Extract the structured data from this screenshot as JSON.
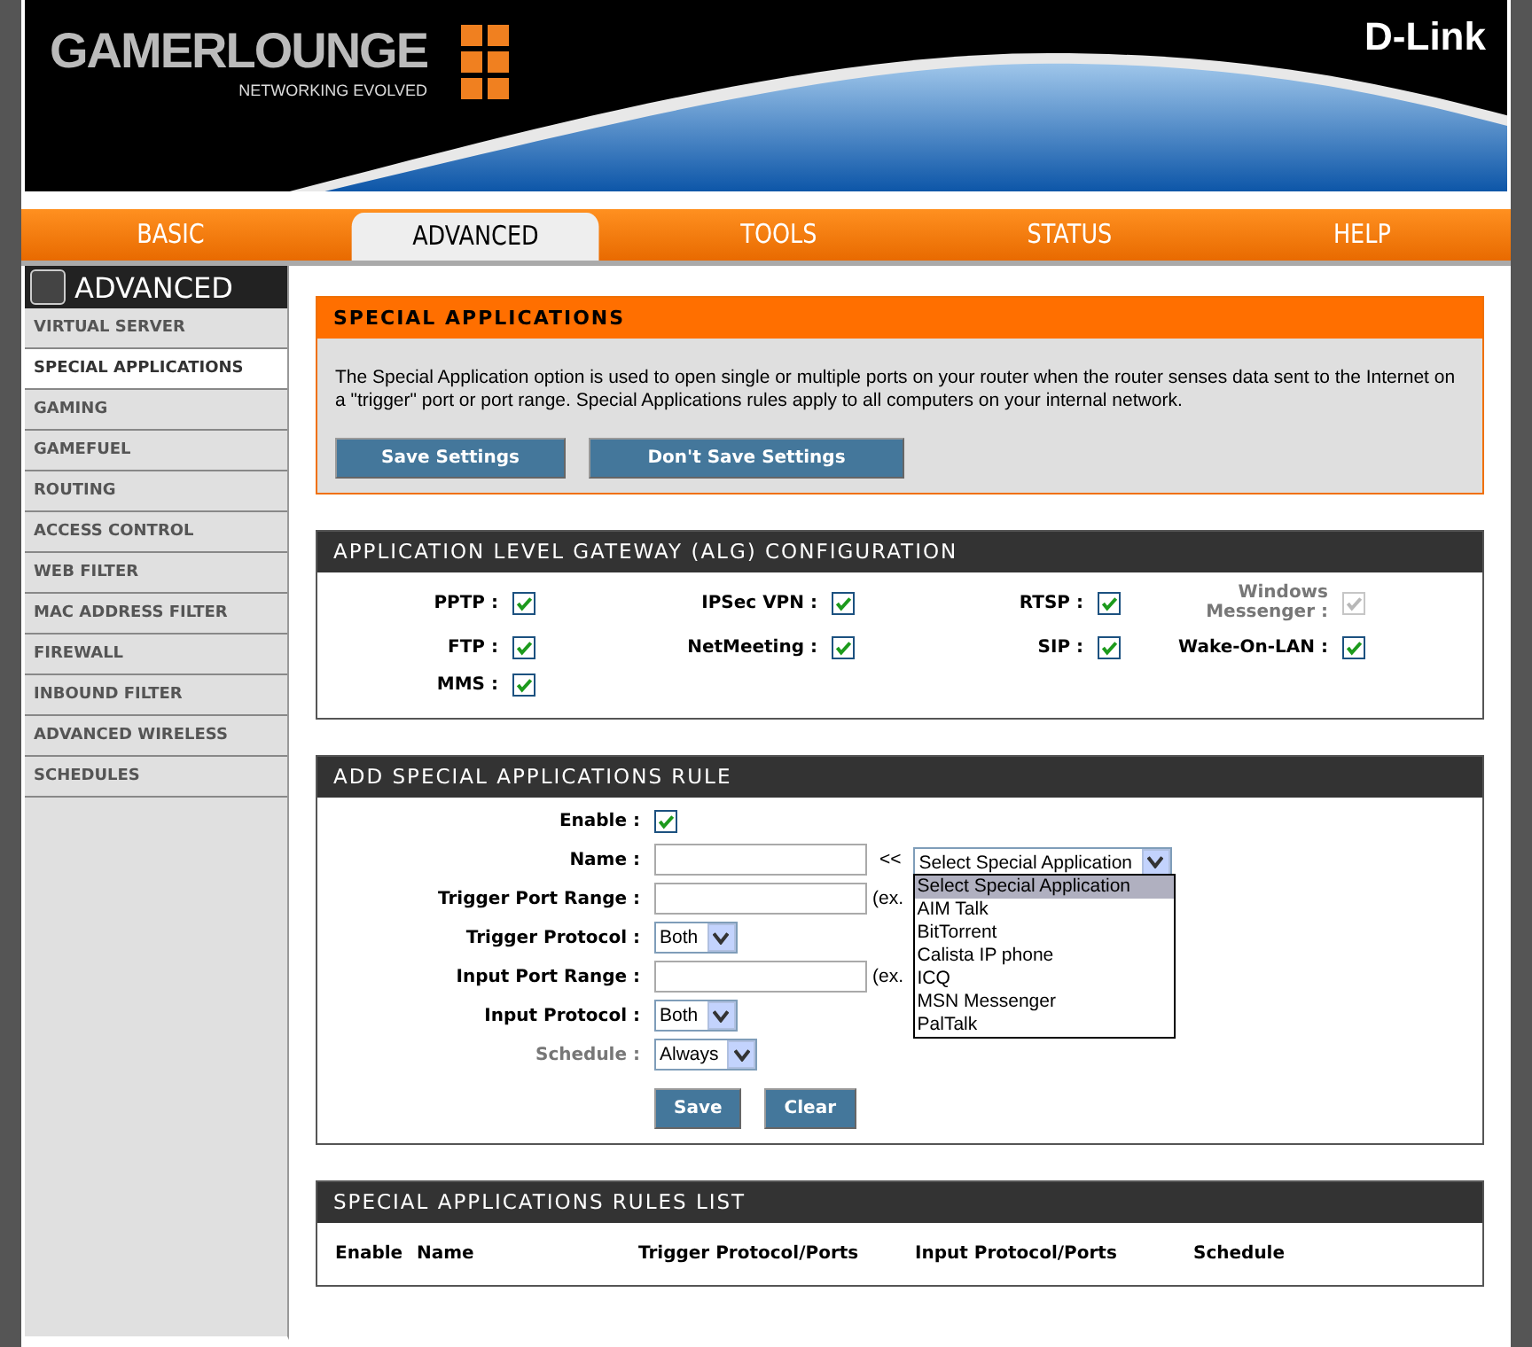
{
  "header": {
    "logo": "GAMERLOUNGE",
    "logo_tagline": "NETWORKING EVOLVED",
    "brand": "D-Link"
  },
  "tabs": [
    {
      "label": "BASIC",
      "selected": false
    },
    {
      "label": "ADVANCED",
      "selected": true
    },
    {
      "label": "TOOLS",
      "selected": false
    },
    {
      "label": "STATUS",
      "selected": false
    },
    {
      "label": "HELP",
      "selected": false
    }
  ],
  "sidebar": {
    "title": "ADVANCED",
    "items": [
      {
        "label": "VIRTUAL SERVER",
        "selected": false
      },
      {
        "label": "SPECIAL APPLICATIONS",
        "selected": true
      },
      {
        "label": "GAMING",
        "selected": false
      },
      {
        "label": "GAMEFUEL",
        "selected": false
      },
      {
        "label": "ROUTING",
        "selected": false
      },
      {
        "label": "ACCESS CONTROL",
        "selected": false
      },
      {
        "label": "WEB FILTER",
        "selected": false
      },
      {
        "label": "MAC ADDRESS FILTER",
        "selected": false
      },
      {
        "label": "FIREWALL",
        "selected": false
      },
      {
        "label": "INBOUND FILTER",
        "selected": false
      },
      {
        "label": "ADVANCED WIRELESS",
        "selected": false
      },
      {
        "label": "SCHEDULES",
        "selected": false
      }
    ]
  },
  "intro": {
    "title": "SPECIAL APPLICATIONS",
    "text": "The Special Application option is used to open single or multiple ports on your router when the router senses data sent to the Internet on a \"trigger\" port or port range. Special Applications rules apply to all computers on your internal network.",
    "buttons": [
      "Save Settings",
      "Don't Save Settings"
    ]
  },
  "alg": {
    "title": "APPLICATION LEVEL GATEWAY (ALG) CONFIGURATION",
    "items": [
      {
        "label": "PPTP :",
        "checked": true,
        "disabled": false
      },
      {
        "label": "IPSec VPN :",
        "checked": true,
        "disabled": false
      },
      {
        "label": "RTSP :",
        "checked": true,
        "disabled": false
      },
      {
        "label": "Windows Messenger :",
        "checked": true,
        "disabled": true
      },
      {
        "label": "FTP :",
        "checked": true,
        "disabled": false
      },
      {
        "label": "NetMeeting :",
        "checked": true,
        "disabled": false
      },
      {
        "label": "SIP :",
        "checked": true,
        "disabled": false
      },
      {
        "label": "Wake-On-LAN :",
        "checked": true,
        "disabled": false
      },
      {
        "label": "MMS :",
        "checked": true,
        "disabled": false
      }
    ]
  },
  "add_rule": {
    "title": "ADD SPECIAL APPLICATIONS RULE",
    "rows": [
      {
        "kind": "checkbox",
        "label": "Enable :",
        "checked": true,
        "disabled": false
      },
      {
        "kind": "name",
        "label": "Name :",
        "disabled": false,
        "value": "",
        "arrow": "<<",
        "select": "Select Special Application",
        "options": [
          {
            "label": "Select Special Application",
            "selected": true
          },
          {
            "label": "AIM Talk",
            "selected": false
          },
          {
            "label": "BitTorrent",
            "selected": false
          },
          {
            "label": "Calista IP phone",
            "selected": false
          },
          {
            "label": "ICQ",
            "selected": false
          },
          {
            "label": "MSN Messenger",
            "selected": false
          },
          {
            "label": "PalTalk",
            "selected": false
          }
        ]
      },
      {
        "kind": "text",
        "label": "Trigger Port Range :",
        "disabled": false,
        "value": "",
        "hint": "(ex."
      },
      {
        "kind": "select",
        "label": "Trigger Protocol :",
        "disabled": false,
        "value": "Both"
      },
      {
        "kind": "text",
        "label": "Input Port Range :",
        "disabled": false,
        "value": "",
        "hint": "(ex."
      },
      {
        "kind": "select",
        "label": "Input Protocol :",
        "disabled": false,
        "value": "Both"
      },
      {
        "kind": "select",
        "label": "Schedule :",
        "disabled": true,
        "value": "Always"
      }
    ],
    "buttons": [
      "Save",
      "Clear"
    ]
  },
  "rules_list": {
    "title": "SPECIAL APPLICATIONS RULES LIST",
    "columns": [
      "Enable",
      "Name",
      "Trigger Protocol/Ports",
      "Input Protocol/Ports",
      "Schedule"
    ]
  }
}
